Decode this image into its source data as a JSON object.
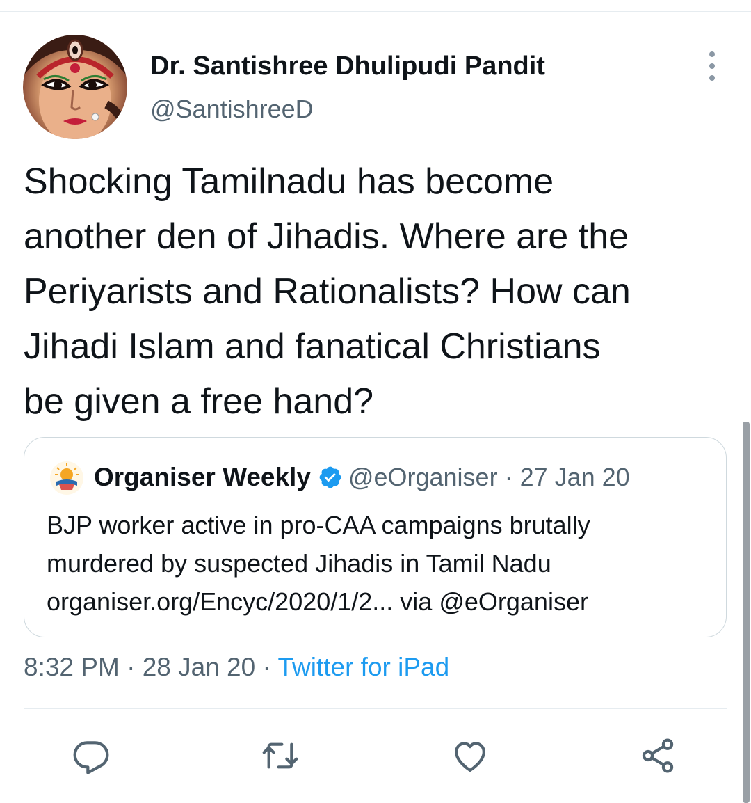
{
  "tweet": {
    "author_name": "Dr. Santishree Dhulipudi Pandit",
    "author_handle": "@SantishreeD",
    "text": "Shocking Tamilnadu has become\nanother den of Jihadis. Where are the\nPeriyarists and Rationalists? How can\nJihadi Islam and fanatical Christians\nbe given a free hand?",
    "time": "8:32 PM",
    "date": "28 Jan 20",
    "source": "Twitter for iPad",
    "separator": " · "
  },
  "quoted_tweet": {
    "author_name": "Organiser Weekly",
    "author_handle": "@eOrganiser",
    "date": "27 Jan 20",
    "separator": " · ",
    "verified": true,
    "text": "BJP worker active in pro-CAA campaigns brutally\nmurdered by suspected Jihadis in Tamil Nadu\norganiser.org/Encyc/2020/1/2... via @eOrganiser"
  },
  "actions": [
    {
      "icon": "reply-icon"
    },
    {
      "icon": "retweet-icon"
    },
    {
      "icon": "like-icon"
    },
    {
      "icon": "share-icon"
    }
  ],
  "colors": {
    "text": "#0f1419",
    "secondary": "#536471",
    "link": "#1d9bf0",
    "verified": "#1d9bf0",
    "border": "#cfd9de"
  }
}
